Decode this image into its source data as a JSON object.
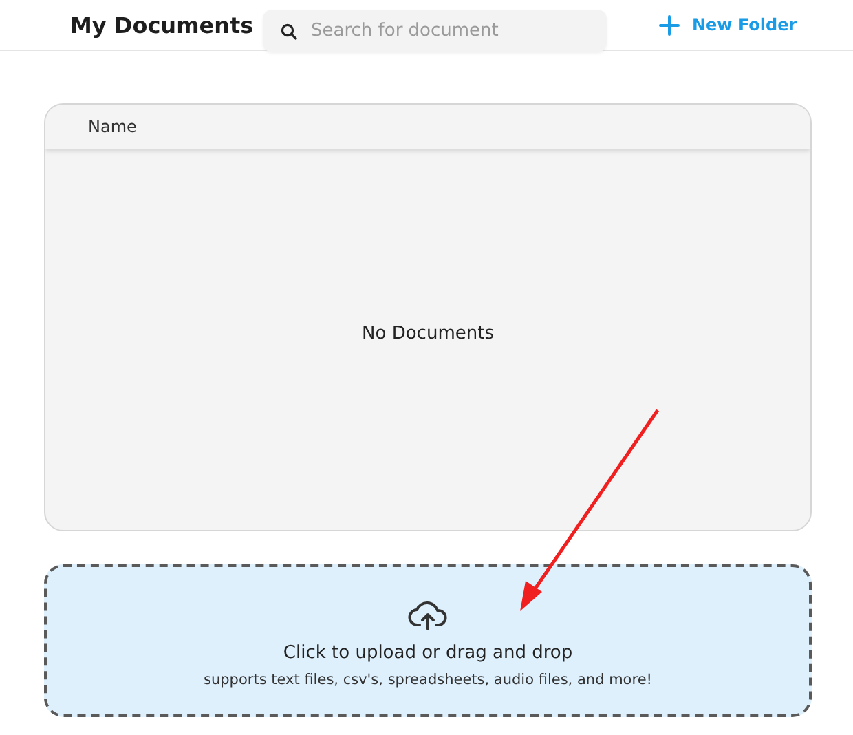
{
  "header": {
    "title": "My Documents",
    "search": {
      "placeholder": "Search for document"
    },
    "new_folder_button": "New Folder"
  },
  "table": {
    "columns": [
      "Name"
    ],
    "empty_message": "No Documents"
  },
  "upload": {
    "title": "Click to upload or drag and drop",
    "subtitle": "supports text files, csv's, spreadsheets, audio files, and more!"
  }
}
